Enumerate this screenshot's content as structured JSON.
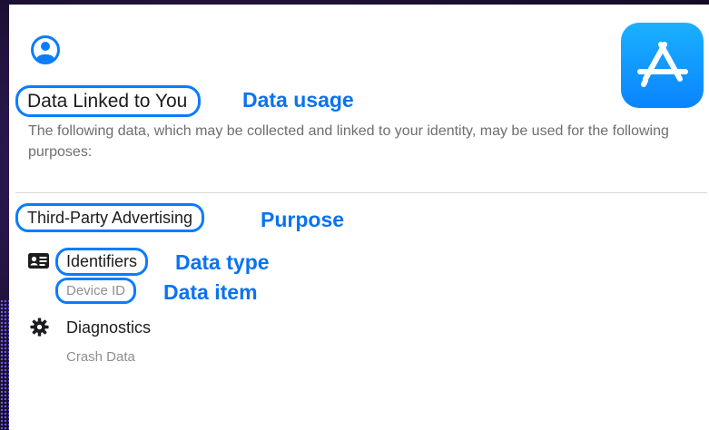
{
  "section": {
    "title": "Data Linked to You",
    "annotation": "Data usage",
    "description": "The following data, which may be collected and linked to your identity, may be used for the following purposes:"
  },
  "purpose": {
    "label": "Third-Party Advertising",
    "annotation": "Purpose"
  },
  "data_type": {
    "label": "Identifiers",
    "annotation": "Data type",
    "icon": "id-card-icon"
  },
  "data_item": {
    "label": "Device ID",
    "annotation": "Data item"
  },
  "diagnostics": {
    "label": "Diagnostics",
    "item": "Crash Data",
    "icon": "gear-icon"
  },
  "colors": {
    "accent": "#0a7cff",
    "annotation": "#0a73f0",
    "appstore_top": "#1ab0ff",
    "appstore_bottom": "#0a84ff"
  }
}
